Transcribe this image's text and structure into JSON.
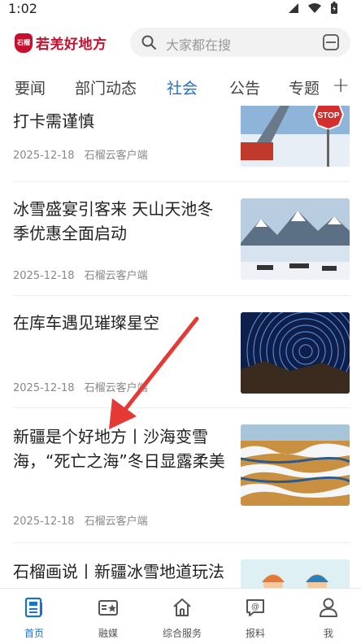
{
  "status_bar": {
    "time": "1:02"
  },
  "header": {
    "logo_mark": "石榴",
    "logo_text": "若羌好地方",
    "search": {
      "placeholder": "大家都在搜"
    }
  },
  "tabs": [
    {
      "label": "要闻",
      "active": false
    },
    {
      "label": "部门动态",
      "active": false
    },
    {
      "label": "社会",
      "active": true
    },
    {
      "label": "公告",
      "active": false
    },
    {
      "label": "专题",
      "active": false
    }
  ],
  "tab_add": "+",
  "articles": [
    {
      "title": "打卡需谨慎",
      "date": "2025-12-18",
      "source": "石榴云客户端",
      "thumb": "stop-sign-snow"
    },
    {
      "title": "冰雪盛宴引客来 天山天池冬季优惠全面启动",
      "date": "2025-12-18",
      "source": "石榴云客户端",
      "thumb": "tianchi-lake"
    },
    {
      "title": "在库车遇见璀璨星空",
      "date": "2025-12-18",
      "source": "石榴云客户端",
      "thumb": "star-trails"
    },
    {
      "title": "新疆是个好地方丨沙海变雪海，“死亡之海”冬日显露柔美",
      "date": "2025-12-18",
      "source": "石榴云客户端",
      "thumb": "snowy-desert"
    },
    {
      "title": "石榴画说丨新疆冰雪地道玩法",
      "date": "",
      "source": "",
      "thumb": "illustration-couple"
    }
  ],
  "bottom_nav": [
    {
      "label": "首页",
      "icon": "home-doc-icon",
      "active": true
    },
    {
      "label": "融媒",
      "icon": "media-star-icon",
      "active": false
    },
    {
      "label": "综合服务",
      "icon": "house-icon",
      "active": false
    },
    {
      "label": "报料",
      "icon": "chat-at-icon",
      "active": false
    },
    {
      "label": "我",
      "icon": "user-icon",
      "active": false
    }
  ],
  "colors": {
    "accent": "#1a73c8",
    "brand": "#c8102e",
    "arrow": "#e53935"
  }
}
